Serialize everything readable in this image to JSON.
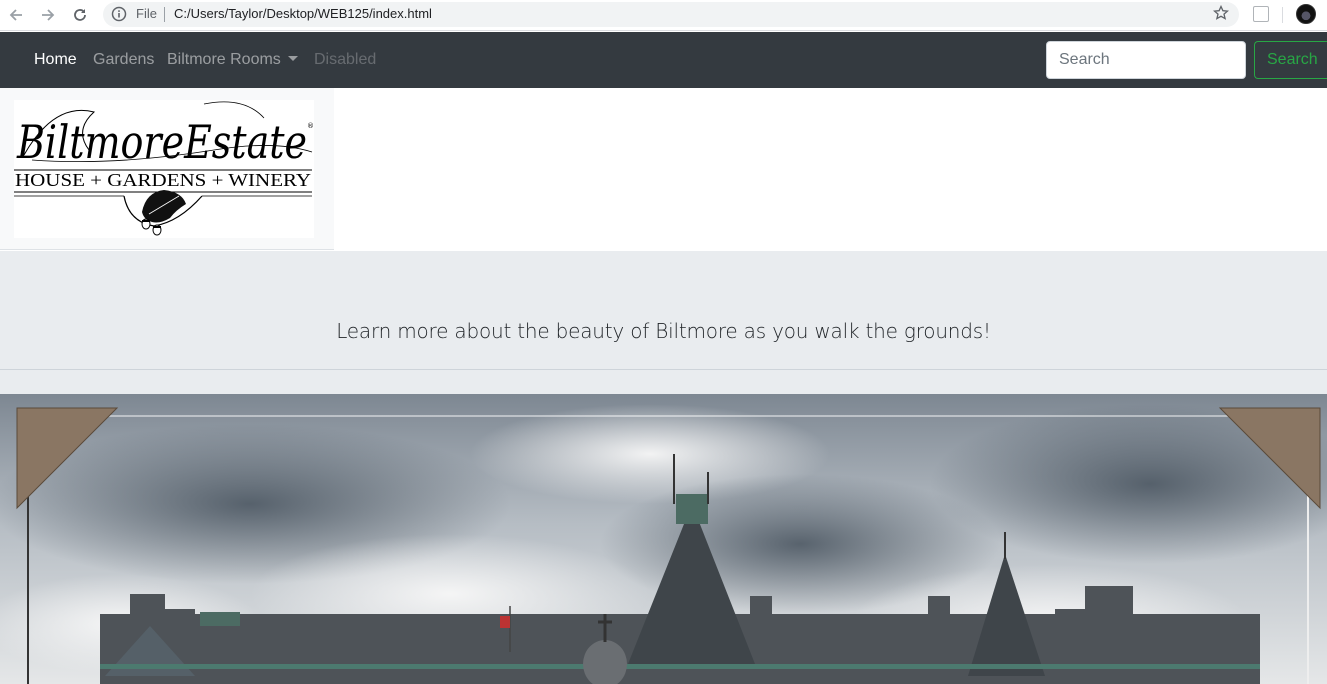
{
  "browser": {
    "file_label": "File",
    "url": "C:/Users/Taylor/Desktop/WEB125/index.html"
  },
  "navbar": {
    "links": [
      {
        "label": "Home",
        "state": "active"
      },
      {
        "label": "Gardens",
        "state": "normal"
      },
      {
        "label": "Biltmore Rooms",
        "state": "dropdown"
      },
      {
        "label": "Disabled",
        "state": "disabled"
      }
    ],
    "search_placeholder": "Search",
    "search_button": "Search",
    "accent_color": "#28a745",
    "bg_color": "#343a40"
  },
  "logo": {
    "title": "BiltmoreEstate",
    "subtitle": "HOUSE + GARDENS + WINERY",
    "registered": "®"
  },
  "jumbotron": {
    "lead": "Learn more about the beauty of Biltmore as you walk the grounds!"
  },
  "hero": {
    "description_icon": "estate-photo"
  }
}
